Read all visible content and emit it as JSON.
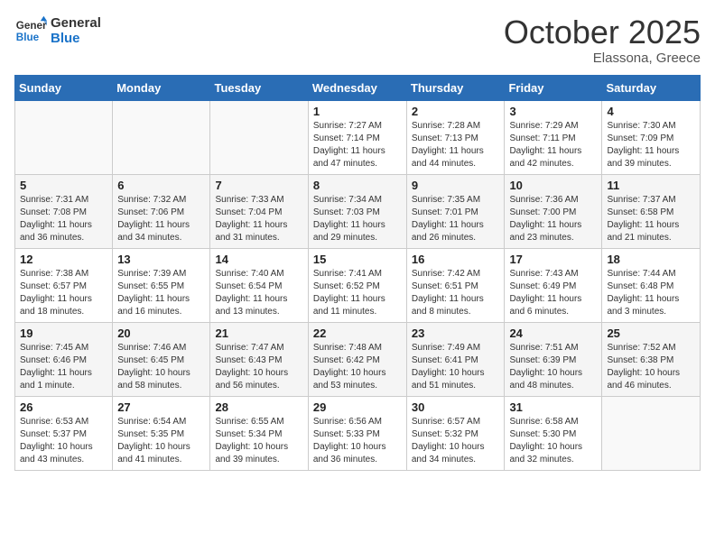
{
  "header": {
    "logo_line1": "General",
    "logo_line2": "Blue",
    "month_title": "October 2025",
    "location": "Elassona, Greece"
  },
  "weekdays": [
    "Sunday",
    "Monday",
    "Tuesday",
    "Wednesday",
    "Thursday",
    "Friday",
    "Saturday"
  ],
  "weeks": [
    [
      {
        "day": "",
        "sunrise": "",
        "sunset": "",
        "daylight": ""
      },
      {
        "day": "",
        "sunrise": "",
        "sunset": "",
        "daylight": ""
      },
      {
        "day": "",
        "sunrise": "",
        "sunset": "",
        "daylight": ""
      },
      {
        "day": "1",
        "sunrise": "Sunrise: 7:27 AM",
        "sunset": "Sunset: 7:14 PM",
        "daylight": "Daylight: 11 hours and 47 minutes."
      },
      {
        "day": "2",
        "sunrise": "Sunrise: 7:28 AM",
        "sunset": "Sunset: 7:13 PM",
        "daylight": "Daylight: 11 hours and 44 minutes."
      },
      {
        "day": "3",
        "sunrise": "Sunrise: 7:29 AM",
        "sunset": "Sunset: 7:11 PM",
        "daylight": "Daylight: 11 hours and 42 minutes."
      },
      {
        "day": "4",
        "sunrise": "Sunrise: 7:30 AM",
        "sunset": "Sunset: 7:09 PM",
        "daylight": "Daylight: 11 hours and 39 minutes."
      }
    ],
    [
      {
        "day": "5",
        "sunrise": "Sunrise: 7:31 AM",
        "sunset": "Sunset: 7:08 PM",
        "daylight": "Daylight: 11 hours and 36 minutes."
      },
      {
        "day": "6",
        "sunrise": "Sunrise: 7:32 AM",
        "sunset": "Sunset: 7:06 PM",
        "daylight": "Daylight: 11 hours and 34 minutes."
      },
      {
        "day": "7",
        "sunrise": "Sunrise: 7:33 AM",
        "sunset": "Sunset: 7:04 PM",
        "daylight": "Daylight: 11 hours and 31 minutes."
      },
      {
        "day": "8",
        "sunrise": "Sunrise: 7:34 AM",
        "sunset": "Sunset: 7:03 PM",
        "daylight": "Daylight: 11 hours and 29 minutes."
      },
      {
        "day": "9",
        "sunrise": "Sunrise: 7:35 AM",
        "sunset": "Sunset: 7:01 PM",
        "daylight": "Daylight: 11 hours and 26 minutes."
      },
      {
        "day": "10",
        "sunrise": "Sunrise: 7:36 AM",
        "sunset": "Sunset: 7:00 PM",
        "daylight": "Daylight: 11 hours and 23 minutes."
      },
      {
        "day": "11",
        "sunrise": "Sunrise: 7:37 AM",
        "sunset": "Sunset: 6:58 PM",
        "daylight": "Daylight: 11 hours and 21 minutes."
      }
    ],
    [
      {
        "day": "12",
        "sunrise": "Sunrise: 7:38 AM",
        "sunset": "Sunset: 6:57 PM",
        "daylight": "Daylight: 11 hours and 18 minutes."
      },
      {
        "day": "13",
        "sunrise": "Sunrise: 7:39 AM",
        "sunset": "Sunset: 6:55 PM",
        "daylight": "Daylight: 11 hours and 16 minutes."
      },
      {
        "day": "14",
        "sunrise": "Sunrise: 7:40 AM",
        "sunset": "Sunset: 6:54 PM",
        "daylight": "Daylight: 11 hours and 13 minutes."
      },
      {
        "day": "15",
        "sunrise": "Sunrise: 7:41 AM",
        "sunset": "Sunset: 6:52 PM",
        "daylight": "Daylight: 11 hours and 11 minutes."
      },
      {
        "day": "16",
        "sunrise": "Sunrise: 7:42 AM",
        "sunset": "Sunset: 6:51 PM",
        "daylight": "Daylight: 11 hours and 8 minutes."
      },
      {
        "day": "17",
        "sunrise": "Sunrise: 7:43 AM",
        "sunset": "Sunset: 6:49 PM",
        "daylight": "Daylight: 11 hours and 6 minutes."
      },
      {
        "day": "18",
        "sunrise": "Sunrise: 7:44 AM",
        "sunset": "Sunset: 6:48 PM",
        "daylight": "Daylight: 11 hours and 3 minutes."
      }
    ],
    [
      {
        "day": "19",
        "sunrise": "Sunrise: 7:45 AM",
        "sunset": "Sunset: 6:46 PM",
        "daylight": "Daylight: 11 hours and 1 minute."
      },
      {
        "day": "20",
        "sunrise": "Sunrise: 7:46 AM",
        "sunset": "Sunset: 6:45 PM",
        "daylight": "Daylight: 10 hours and 58 minutes."
      },
      {
        "day": "21",
        "sunrise": "Sunrise: 7:47 AM",
        "sunset": "Sunset: 6:43 PM",
        "daylight": "Daylight: 10 hours and 56 minutes."
      },
      {
        "day": "22",
        "sunrise": "Sunrise: 7:48 AM",
        "sunset": "Sunset: 6:42 PM",
        "daylight": "Daylight: 10 hours and 53 minutes."
      },
      {
        "day": "23",
        "sunrise": "Sunrise: 7:49 AM",
        "sunset": "Sunset: 6:41 PM",
        "daylight": "Daylight: 10 hours and 51 minutes."
      },
      {
        "day": "24",
        "sunrise": "Sunrise: 7:51 AM",
        "sunset": "Sunset: 6:39 PM",
        "daylight": "Daylight: 10 hours and 48 minutes."
      },
      {
        "day": "25",
        "sunrise": "Sunrise: 7:52 AM",
        "sunset": "Sunset: 6:38 PM",
        "daylight": "Daylight: 10 hours and 46 minutes."
      }
    ],
    [
      {
        "day": "26",
        "sunrise": "Sunrise: 6:53 AM",
        "sunset": "Sunset: 5:37 PM",
        "daylight": "Daylight: 10 hours and 43 minutes."
      },
      {
        "day": "27",
        "sunrise": "Sunrise: 6:54 AM",
        "sunset": "Sunset: 5:35 PM",
        "daylight": "Daylight: 10 hours and 41 minutes."
      },
      {
        "day": "28",
        "sunrise": "Sunrise: 6:55 AM",
        "sunset": "Sunset: 5:34 PM",
        "daylight": "Daylight: 10 hours and 39 minutes."
      },
      {
        "day": "29",
        "sunrise": "Sunrise: 6:56 AM",
        "sunset": "Sunset: 5:33 PM",
        "daylight": "Daylight: 10 hours and 36 minutes."
      },
      {
        "day": "30",
        "sunrise": "Sunrise: 6:57 AM",
        "sunset": "Sunset: 5:32 PM",
        "daylight": "Daylight: 10 hours and 34 minutes."
      },
      {
        "day": "31",
        "sunrise": "Sunrise: 6:58 AM",
        "sunset": "Sunset: 5:30 PM",
        "daylight": "Daylight: 10 hours and 32 minutes."
      },
      {
        "day": "",
        "sunrise": "",
        "sunset": "",
        "daylight": ""
      }
    ]
  ]
}
